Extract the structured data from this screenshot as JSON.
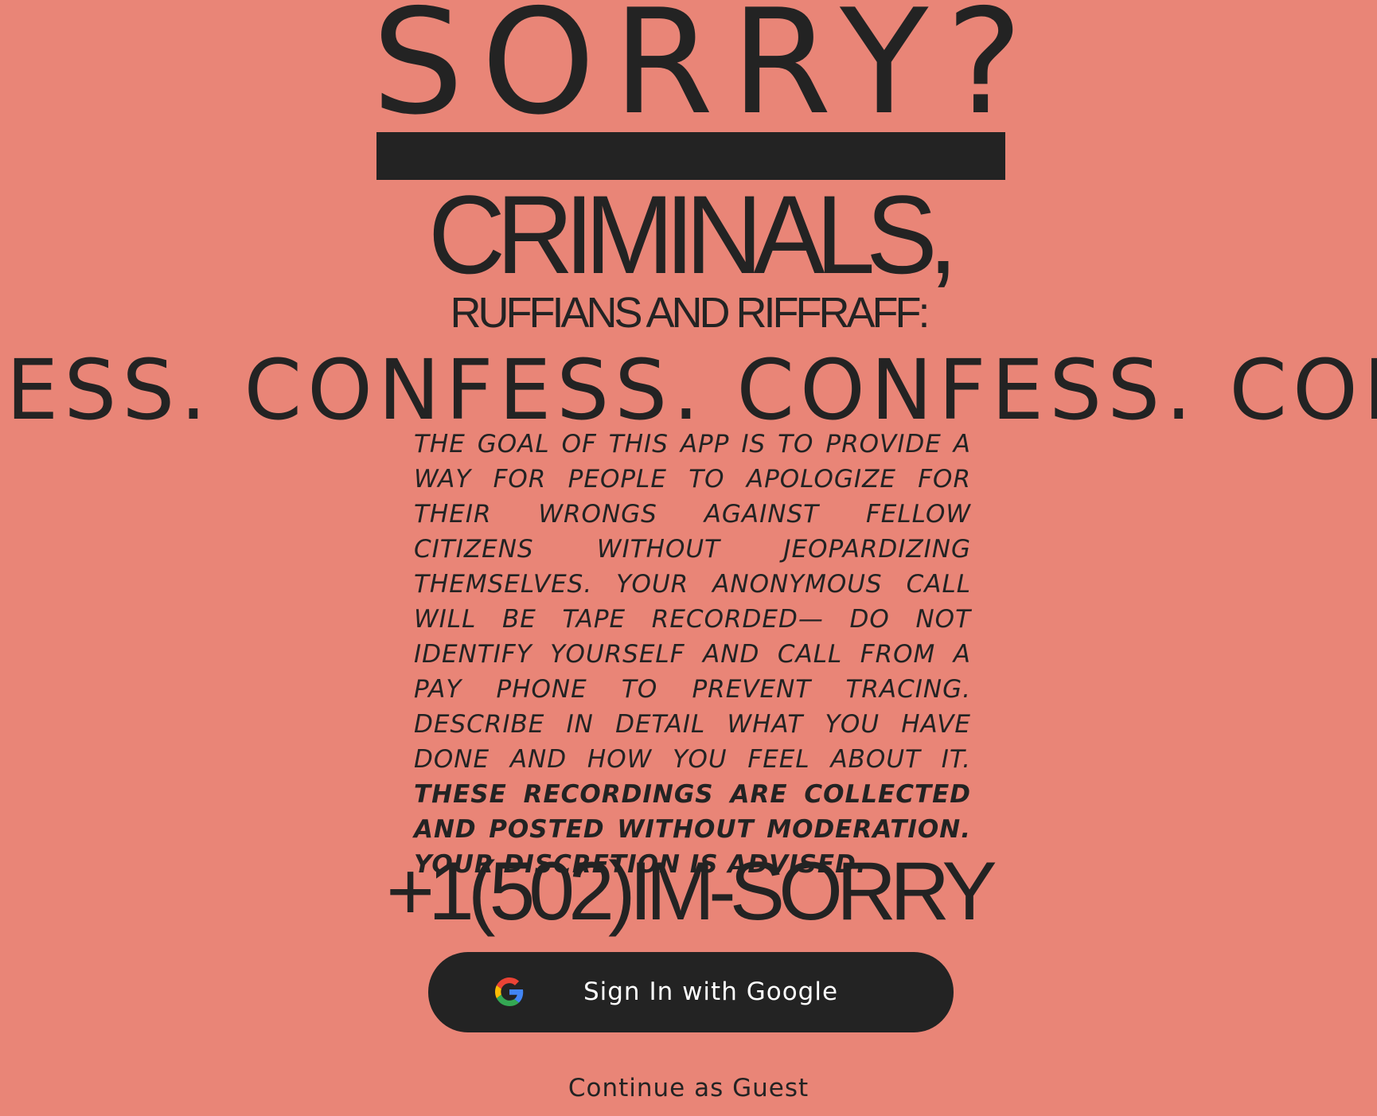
{
  "hero": {
    "title": "SORRY?",
    "subtitle": "CRIMINALS,",
    "subtitle2": "RUFFIANS AND RIFFRAFF:"
  },
  "marquee": {
    "text": "NFESS. CONFESS. CONFESS. CON"
  },
  "notice": {
    "body": "THE GOAL OF THIS APP IS TO PROVIDE A WAY FOR PEOPLE TO APOLOGIZE FOR THEIR WRONGS AGAINST FELLOW CITIZENS WITHOUT JEOPARDIZING THEMSELVES. YOUR ANONYMOUS CALL WILL BE TAPE RECORDED— DO NOT IDENTIFY YOURSELF AND CALL FROM A PAY PHONE TO PREVENT TRACING. DESCRIBE IN DETAIL WHAT YOU HAVE DONE AND HOW YOU FEEL ABOUT IT.",
    "warning": "THESE RECORDINGS ARE COLLECTED AND POSTED WITHOUT MODERATION. YOUR DISCRETION IS ADVISED."
  },
  "phone": {
    "number": "+1(502)IM-SORRY"
  },
  "actions": {
    "google_label": "Sign In with Google",
    "guest_label": "Continue as Guest"
  },
  "icons": {
    "google": "google-g-icon"
  },
  "colors": {
    "background": "#E98577",
    "ink": "#232323",
    "button_text": "#FFFFFF"
  }
}
